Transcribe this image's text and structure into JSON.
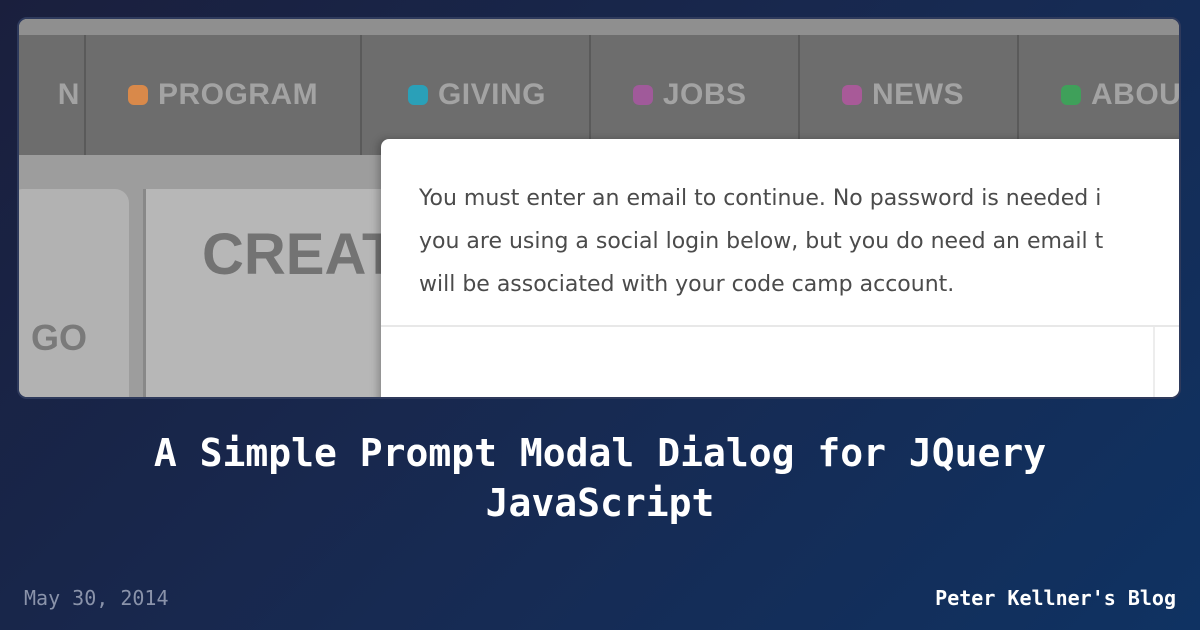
{
  "screenshot": {
    "nav": {
      "items": [
        {
          "label": "N",
          "dot_color": null
        },
        {
          "label": "PROGRAM",
          "dot_color": "#d9894a"
        },
        {
          "label": "GIVING",
          "dot_color": "#2aa0b8"
        },
        {
          "label": "JOBS",
          "dot_color": "#a05a9a"
        },
        {
          "label": "NEWS",
          "dot_color": "#a85a98"
        },
        {
          "label": "ABOU",
          "dot_color": "#3fa05a"
        }
      ]
    },
    "page": {
      "left_panel_text": "GO",
      "main_heading": "CREAT"
    },
    "modal": {
      "message_lines": [
        "You must enter an email to continue. No password is needed i",
        "you are using a social login below, but you do need an email t",
        "will be associated with your code camp account."
      ]
    }
  },
  "post": {
    "title": "A Simple Prompt Modal Dialog for JQuery JavaScript",
    "date": "May 30, 2014",
    "blog_name": "Peter Kellner's Blog"
  },
  "colors": {
    "background_start": "#1a1f3d",
    "background_end": "#0f3262",
    "nav_background": "#6d6d6d",
    "title_text": "#ffffff"
  }
}
